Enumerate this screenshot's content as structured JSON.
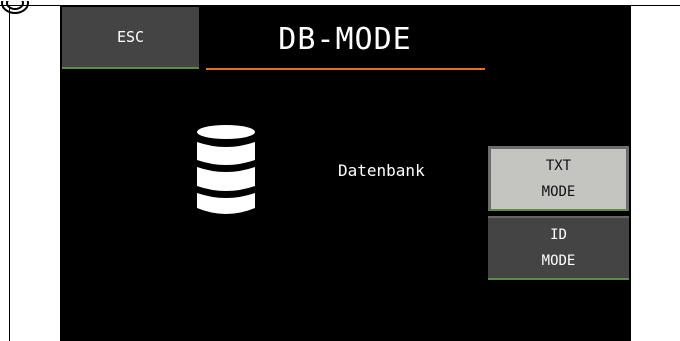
{
  "header": {
    "esc_label": "ESC",
    "title": "DB-MODE"
  },
  "main": {
    "icon": "database-icon",
    "label": "Datenbank"
  },
  "side_buttons": {
    "txt_mode": {
      "line1": "TXT",
      "line2": "MODE",
      "selected": true
    },
    "id_mode": {
      "line1": "ID",
      "line2": "MODE",
      "selected": false
    }
  },
  "colors": {
    "screen_bg": "#000000",
    "button_bg": "#444444",
    "selected_button_bg": "#c4c4c0",
    "accent_orange": "#e0702a",
    "accent_green": "#5f8a4a"
  }
}
